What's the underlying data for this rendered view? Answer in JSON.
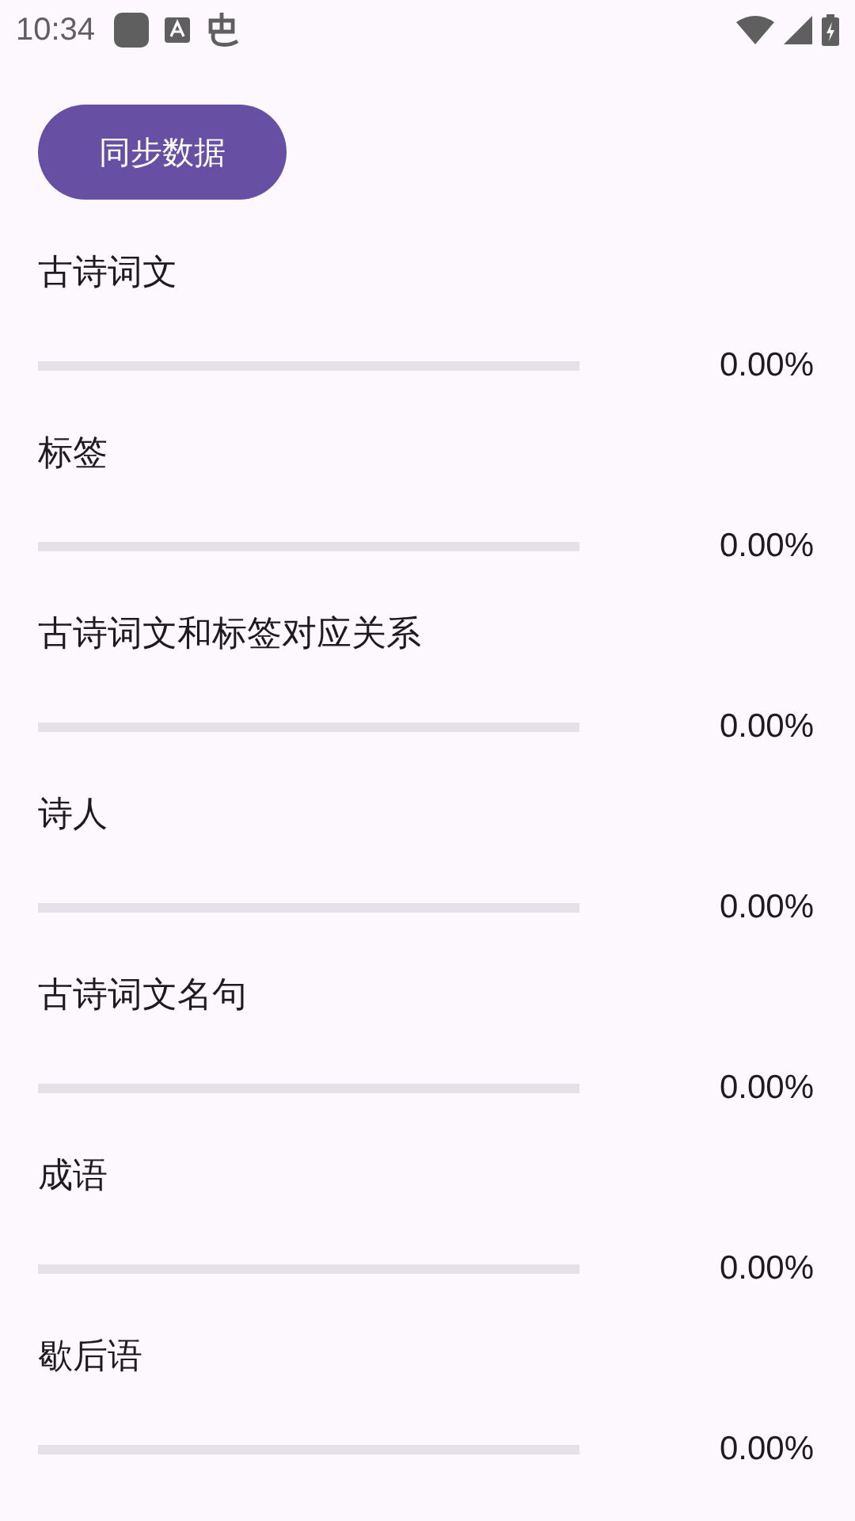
{
  "status_bar": {
    "time": "10:34"
  },
  "sync_button": {
    "label": "同步数据"
  },
  "tables": [
    {
      "name": "古诗词文",
      "level": 0,
      "reading": "0.00%"
    },
    {
      "name": "标签",
      "level": 0,
      "reading": "0.00%"
    },
    {
      "name": "古诗词文和标签对应关系",
      "level": 0,
      "reading": "0.00%"
    },
    {
      "name": "诗人",
      "level": 0,
      "reading": "0.00%"
    },
    {
      "name": "古诗词文名句",
      "level": 0,
      "reading": "0.00%"
    },
    {
      "name": "成语",
      "level": 0,
      "reading": "0.00%"
    },
    {
      "name": "歇后语",
      "level": 0,
      "reading": "0.00%"
    }
  ]
}
